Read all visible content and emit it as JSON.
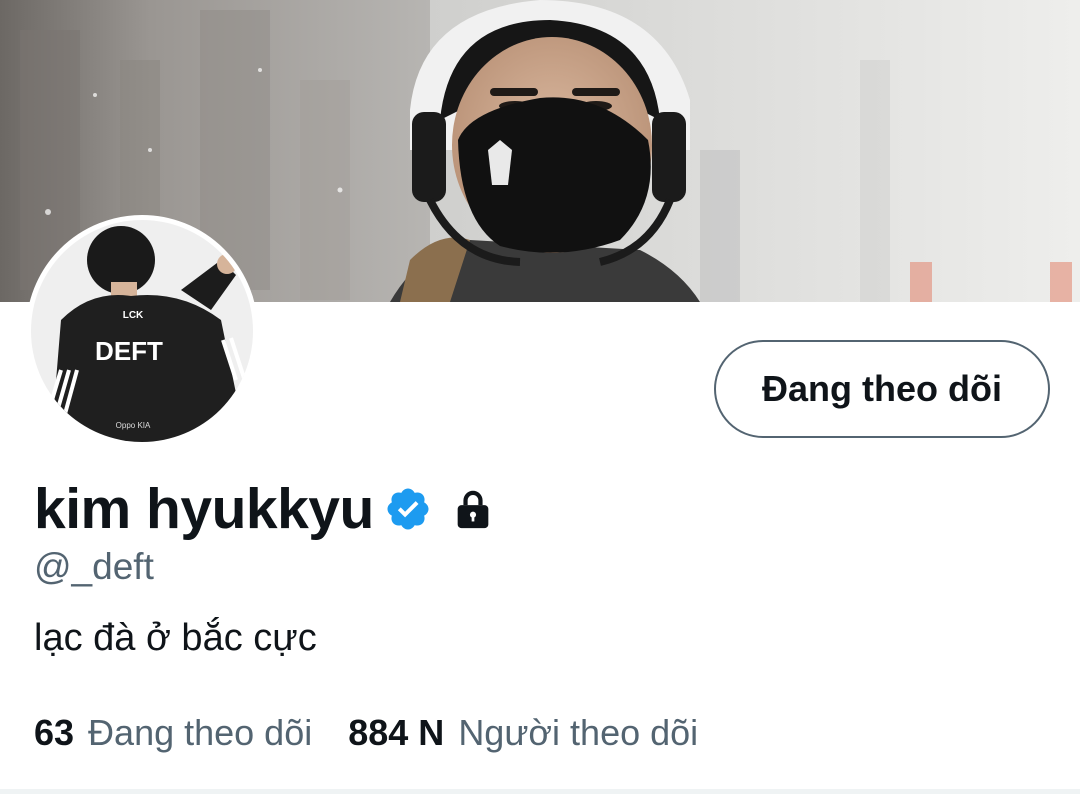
{
  "profile": {
    "display_name": "kim hyukkyu",
    "handle": "@_deft",
    "bio": "lạc đà ở bắc cực",
    "verified": true,
    "protected": true
  },
  "avatar": {
    "jacket_text": "DEFT",
    "jacket_logo": "LCK",
    "jacket_sponsor": "Oppo KIA"
  },
  "actions": {
    "follow_button_label": "Đang theo dõi"
  },
  "stats": {
    "following_count": "63",
    "following_label": "Đang theo dõi",
    "followers_count": "884 N",
    "followers_label": "Người theo dõi"
  },
  "colors": {
    "verified_blue": "#1d9bf0",
    "text_primary": "#0f1419",
    "text_secondary": "#536471",
    "button_border": "#536471"
  },
  "icons": {
    "verified": "verified-badge-icon",
    "lock": "lock-icon"
  }
}
